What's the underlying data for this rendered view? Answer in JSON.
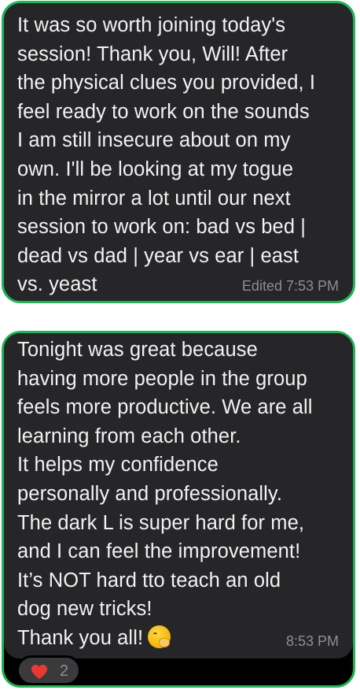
{
  "messages": [
    {
      "text": "It was so worth joining today's\nsession! Thank you, Will! After\nthe physical clues you provided, I\nfeel ready to work on the sounds\nI am still insecure about on my\nown. I'll be looking at my togue\nin the mirror a lot until our next\nsession to work on: bad vs bed |\ndead vs dad | year vs ear | east\nvs. yeast",
      "meta": "Edited 7:53 PM"
    },
    {
      "text": "Tonight was great because\nhaving more people in the group\nfeels more productive. We are all\nlearning from each other.\nIt helps my confidence\npersonally and professionally.\nThe dark L is super hard for me,\nand I can feel the improvement!\nIt’s NOT hard tto teach an old\ndog new tricks!\nThank you all!",
      "emoji": "hand-over-mouth-emoji",
      "meta": "8:53 PM",
      "reaction": {
        "icon": "heart-icon",
        "count": "2"
      }
    }
  ],
  "colors": {
    "bubble_background": "#262628",
    "bubble_border": "#21b356",
    "text": "#f2f2f2",
    "meta_text": "#8e8e93",
    "heart": "#e53935"
  }
}
